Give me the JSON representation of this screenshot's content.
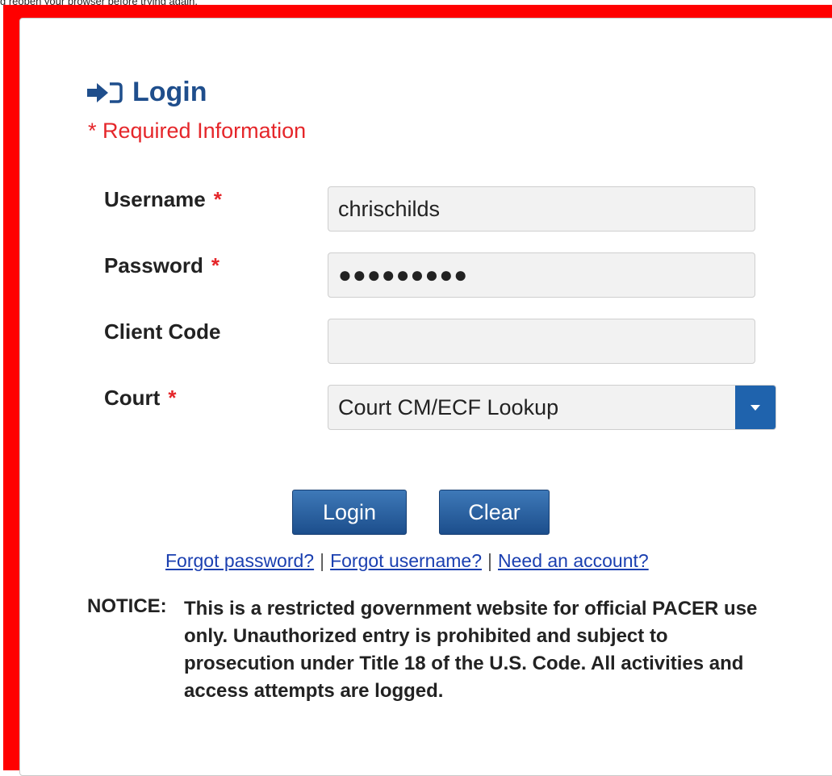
{
  "top_note": "d reopen your browser before trying again.",
  "login": {
    "title": "Login",
    "required_info": "* Required Information"
  },
  "fields": {
    "username": {
      "label": "Username",
      "value": "chrischilds",
      "required_mark": "*"
    },
    "password": {
      "label": "Password",
      "value": "●●●●●●●●●",
      "required_mark": "*"
    },
    "client_code": {
      "label": "Client Code",
      "value": ""
    },
    "court": {
      "label": "Court",
      "selected": "Court CM/ECF Lookup",
      "required_mark": "*"
    }
  },
  "buttons": {
    "login": "Login",
    "clear": "Clear"
  },
  "links": {
    "forgot_password": "Forgot password?",
    "separator": "|",
    "forgot_username": "Forgot username?",
    "need_account": "Need an account?"
  },
  "notice": {
    "label": "NOTICE:",
    "text": "This is a restricted government website for official PACER use only. Unauthorized entry is prohibited and subject to prosecution under Title 18 of the U.S. Code. All activities and access attempts are logged."
  },
  "colors": {
    "frame": "#ff0000",
    "title": "#1f4e8c",
    "required": "#e5262a",
    "button": "#1c4e8c",
    "link": "#1a3fb0"
  }
}
